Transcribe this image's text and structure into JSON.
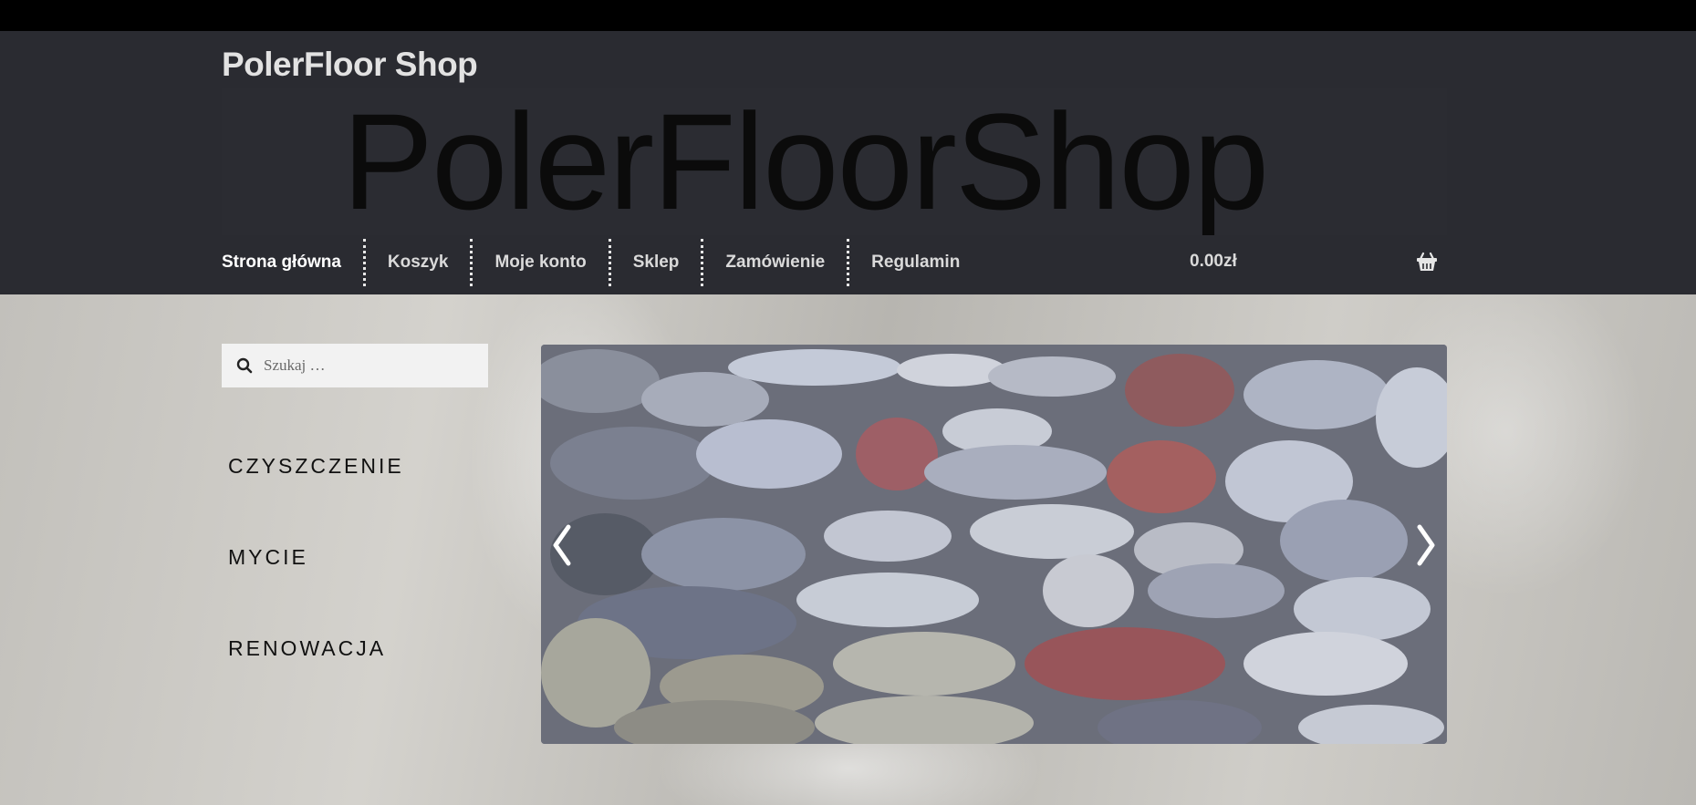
{
  "header": {
    "site_title": "PolerFloor Shop",
    "logo_text": "PolerFloorShop"
  },
  "nav": {
    "items": [
      {
        "label": "Strona główna"
      },
      {
        "label": "Koszyk"
      },
      {
        "label": "Moje konto"
      },
      {
        "label": "Sklep"
      },
      {
        "label": "Zamówienie"
      },
      {
        "label": "Regulamin"
      }
    ],
    "cart_total": "0.00zł",
    "cart_icon": "basket-icon"
  },
  "sidebar": {
    "search": {
      "placeholder": "Szukaj …",
      "icon": "search-icon"
    },
    "categories": [
      {
        "label": "CZYSZCZENIE"
      },
      {
        "label": "MYCIE"
      },
      {
        "label": "RENOWACJA"
      }
    ]
  },
  "slider": {
    "prev_icon": "chevron-left-icon",
    "next_icon": "chevron-right-icon"
  },
  "colors": {
    "topbar": "#000000",
    "header": "#2a2b31",
    "nav_text": "#dadada"
  }
}
